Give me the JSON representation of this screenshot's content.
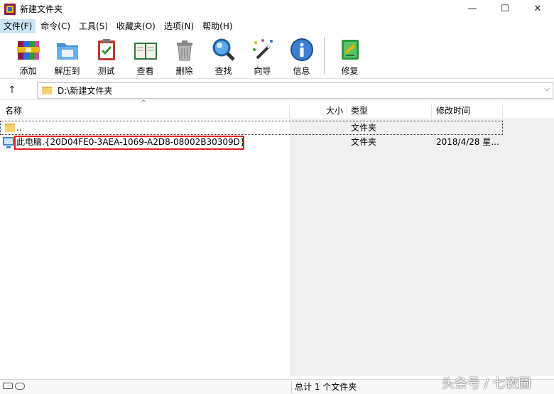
{
  "window": {
    "title": "新建文件夹",
    "minimize_glyph": "—",
    "maximize_glyph": "☐",
    "close_glyph": "✕"
  },
  "menu": [
    "文件(F)",
    "命令(C)",
    "工具(S)",
    "收藏夹(O)",
    "选项(N)",
    "帮助(H)"
  ],
  "toolbar": {
    "add_label": "添加",
    "extract_label": "解压到",
    "test_label": "测试",
    "view_label": "查看",
    "delete_label": "删除",
    "find_label": "查找",
    "wizard_label": "向导",
    "info_label": "信息",
    "repair_label": "修复"
  },
  "address": {
    "up_glyph": "↑",
    "path": "D:\\新建文件夹",
    "dropdown_glyph": "⌵"
  },
  "columns": {
    "name": "名称",
    "size": "大小",
    "type": "类型",
    "modified": "修改时间",
    "sort_glyph": "^"
  },
  "rows": [
    {
      "name": "..",
      "size": "",
      "type": "文件夹",
      "modified": "",
      "icon": "folder-icon"
    },
    {
      "name": "此电脑.{20D04FE0-3AEA-1069-A2D8-08002B30309D}",
      "size": "",
      "type": "文件夹",
      "modified": "2018/4/28 星...",
      "icon": "computer-icon"
    }
  ],
  "status": {
    "summary": "总计 1 个文件夹"
  },
  "watermark": "头条号 / 七夜圆",
  "colors": {
    "menu_active_bg": "#cce4f7",
    "highlight_border": "#e02020",
    "folder_yellow": "#f7d26c"
  }
}
